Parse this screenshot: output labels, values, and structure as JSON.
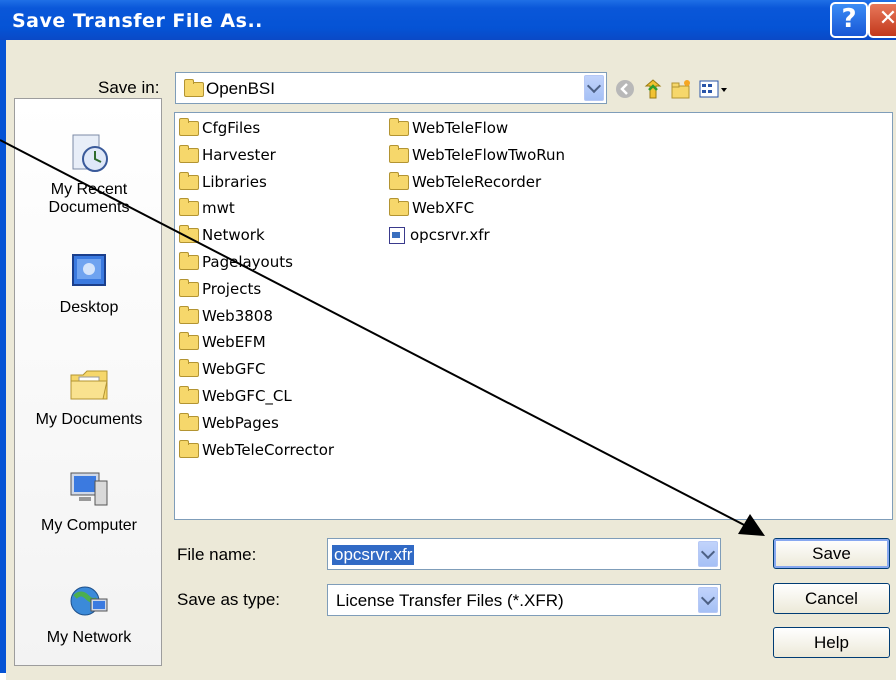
{
  "dialog": {
    "title": "Save Transfer File As..",
    "help_glyph": "?",
    "close_glyph": "✕"
  },
  "save_in": {
    "label": "Save in:",
    "value": "OpenBSI"
  },
  "places": [
    {
      "label": "My Recent Documents",
      "icon": "recent-documents-icon"
    },
    {
      "label": "Desktop",
      "icon": "desktop-icon"
    },
    {
      "label": "My Documents",
      "icon": "my-documents-icon"
    },
    {
      "label": "My Computer",
      "icon": "my-computer-icon"
    },
    {
      "label": "My Network",
      "icon": "my-network-icon"
    }
  ],
  "files": {
    "column1": [
      "CfgFiles",
      "Harvester",
      "Libraries",
      "mwt",
      "Network",
      "Pagelayouts",
      "Projects",
      "Web3808",
      "WebEFM",
      "WebGFC",
      "WebGFC_CL",
      "WebPages",
      "WebTeleCorrector"
    ],
    "column2_folders": [
      "WebTeleFlow",
      "WebTeleFlowTwoRun",
      "WebTeleRecorder",
      "WebXFC"
    ],
    "column2_file": "opcsrvr.xfr"
  },
  "file_name": {
    "label": "File name:",
    "value": "opcsrvr.xfr"
  },
  "save_as_type": {
    "label": "Save as type:",
    "value": "License Transfer Files (*.XFR)"
  },
  "buttons": {
    "save": "Save",
    "cancel": "Cancel",
    "help": "Help"
  },
  "colors": {
    "titlebar": "#0553d5",
    "dialog_bg": "#ece9d8",
    "selection": "#316ac5"
  }
}
